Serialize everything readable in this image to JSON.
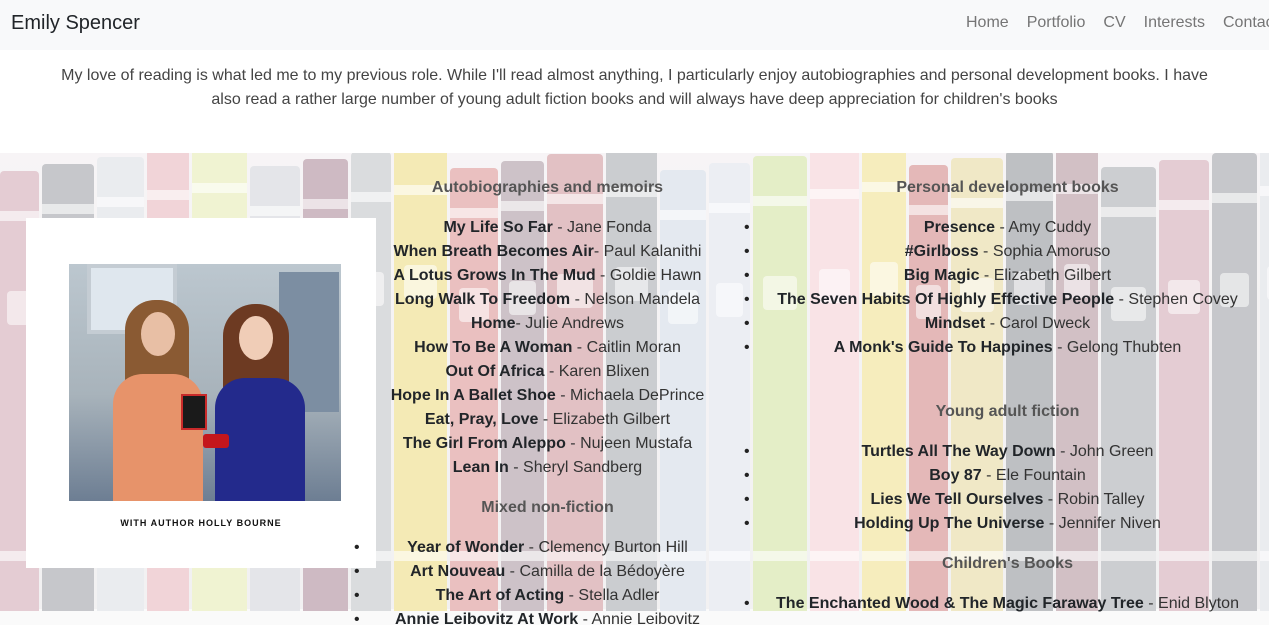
{
  "navbar": {
    "brand": "Emily Spencer",
    "links": [
      "Home",
      "Portfolio",
      "CV",
      "Interests",
      "Contact"
    ]
  },
  "intro_text": "My love of reading is what led me to my previous role. While I'll read almost anything, I particularly enjoy autobiographies and personal development books. I have also read a rather large number of young adult fiction books and will always have deep appreciation for children's books",
  "photo": {
    "caption": "WITH AUTHOR HOLLY BOURNE"
  },
  "sections": {
    "autobiographies": {
      "title": "Autobiographies and memoirs",
      "items": [
        {
          "title": "My Life So Far",
          "author": " - Jane Fonda"
        },
        {
          "title": "When Breath Becomes Air",
          "author": "- Paul Kalanithi"
        },
        {
          "title": "A Lotus Grows In The Mud",
          "author": " - Goldie Hawn"
        },
        {
          "title": "Long Walk To Freedom",
          "author": " - Nelson Mandela"
        },
        {
          "title": "Home",
          "author": "- Julie Andrews"
        },
        {
          "title": "How To Be A Woman",
          "author": " - Caitlin Moran"
        },
        {
          "title": "Out Of Africa",
          "author": " - Karen Blixen"
        },
        {
          "title": "Hope In A Ballet Shoe",
          "author": " - Michaela DePrince"
        },
        {
          "title": "Eat, Pray, Love",
          "author": " - Elizabeth Gilbert"
        },
        {
          "title": "The Girl From Aleppo",
          "author": " - Nujeen Mustafa"
        },
        {
          "title": "Lean In",
          "author": " - Sheryl Sandberg"
        }
      ]
    },
    "mixed": {
      "title": "Mixed non-fiction",
      "items": [
        {
          "title": "Year of Wonder",
          "author": " - Clemency Burton Hill"
        },
        {
          "title": "Art Nouveau",
          "author": " - Camilla de la Bédoyère"
        },
        {
          "title": "The Art of Acting",
          "author": " - Stella Adler"
        },
        {
          "title": "Annie Leibovitz At Work",
          "author": " - Annie Leibovitz"
        }
      ]
    },
    "personal": {
      "title": "Personal development books",
      "items": [
        {
          "title": "Presence",
          "author": " - Amy Cuddy"
        },
        {
          "title": "#Girlboss",
          "author": " - Sophia Amoruso"
        },
        {
          "title": "Big Magic",
          "author": " - Elizabeth Gilbert"
        },
        {
          "title": "The Seven Habits Of Highly Effective People",
          "author": " - Stephen Covey"
        },
        {
          "title": "Mindset",
          "author": " - Carol Dweck"
        },
        {
          "title": "A Monk's Guide To Happines",
          "author": " - Gelong Thubten"
        }
      ]
    },
    "young_adult": {
      "title": "Young adult fiction",
      "items": [
        {
          "title": "Turtles All The Way Down",
          "author": " - John Green"
        },
        {
          "title": "Boy 87",
          "author": " - Ele Fountain"
        },
        {
          "title": "Lies We Tell Ourselves",
          "author": " - Robin Talley"
        },
        {
          "title": "Holding Up The Universe",
          "author": " - Jennifer Niven"
        }
      ]
    },
    "children": {
      "title": "Children's Books",
      "items": [
        {
          "title": "The Enchanted Wood & The Magic Faraway Tree",
          "author": " - Enid Blyton"
        }
      ]
    }
  }
}
